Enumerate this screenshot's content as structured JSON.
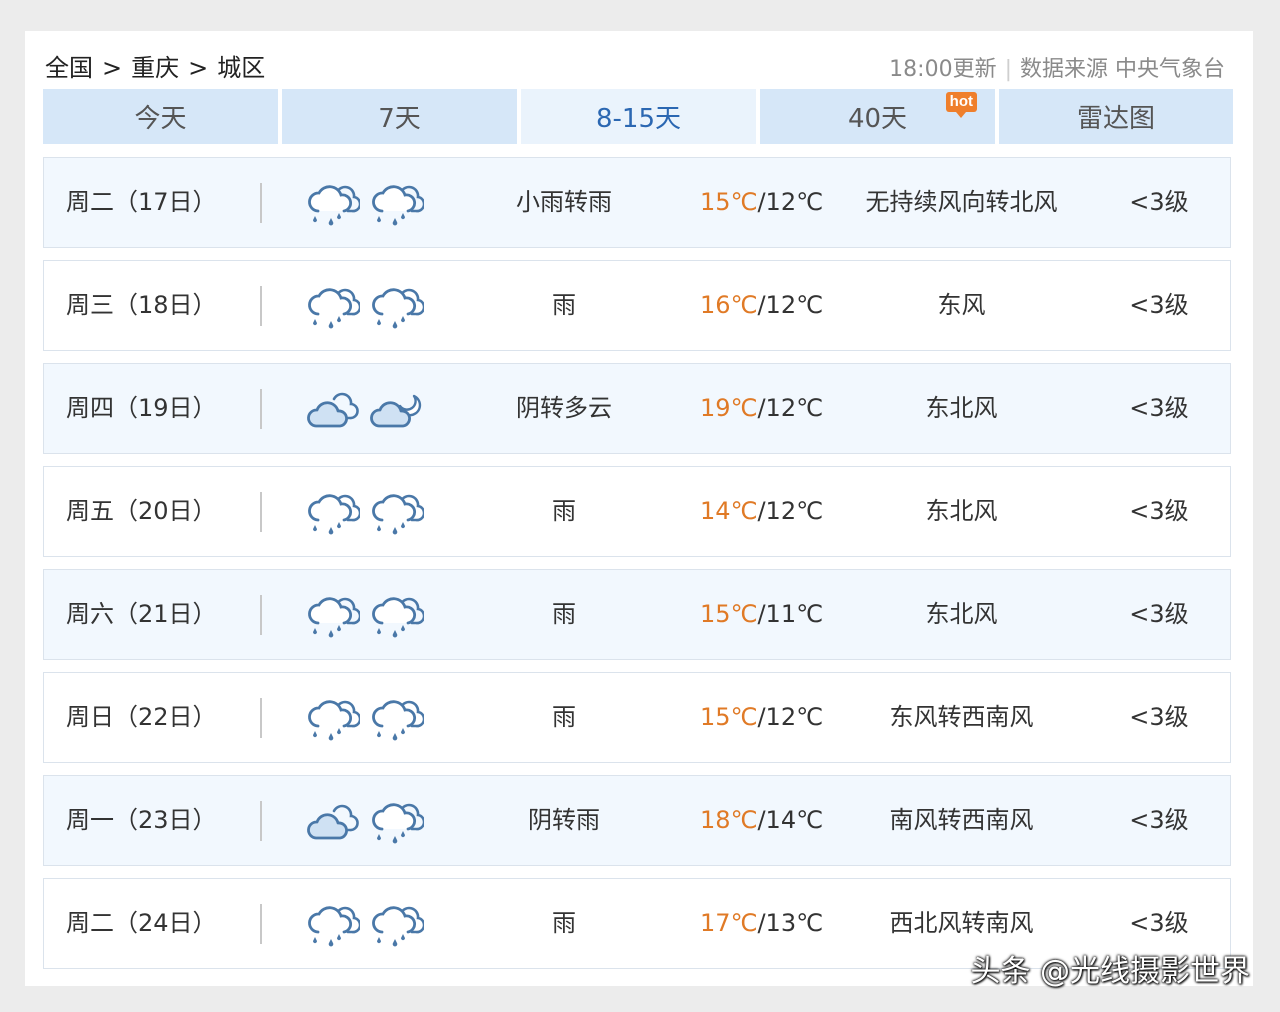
{
  "breadcrumb": {
    "country": "全国",
    "city": "重庆",
    "district": "城区",
    "separator": ">"
  },
  "header": {
    "update": "18:00更新",
    "source": "数据来源 中央气象台"
  },
  "tabs": [
    {
      "label": "今天"
    },
    {
      "label": "7天"
    },
    {
      "label": "8-15天",
      "active": true
    },
    {
      "label": "40天",
      "badge": "hot"
    },
    {
      "label": "雷达图"
    }
  ],
  "colors": {
    "high_temp": "#e07a26",
    "active_tab": "#2b67b2",
    "tab_bg": "#d6e7f8",
    "row_alt_bg": "#f2f8fe"
  },
  "forecast": [
    {
      "day": "周二（17日）",
      "icon_day": "rain-cloud-icon",
      "icon_night": "rain-cloud-icon",
      "weather": "小雨转雨",
      "high": "15℃",
      "sep": "/",
      "low": "12℃",
      "wind": "无持续风向转北风",
      "level": "<3级"
    },
    {
      "day": "周三（18日）",
      "icon_day": "rain-cloud-icon",
      "icon_night": "rain-cloud-icon",
      "weather": "雨",
      "high": "16℃",
      "sep": "/",
      "low": "12℃",
      "wind": "东风",
      "level": "<3级"
    },
    {
      "day": "周四（19日）",
      "icon_day": "overcast-cloud-icon",
      "icon_night": "cloudy-night-icon",
      "weather": "阴转多云",
      "high": "19℃",
      "sep": "/",
      "low": "12℃",
      "wind": "东北风",
      "level": "<3级"
    },
    {
      "day": "周五（20日）",
      "icon_day": "rain-cloud-icon",
      "icon_night": "rain-cloud-icon",
      "weather": "雨",
      "high": "14℃",
      "sep": "/",
      "low": "12℃",
      "wind": "东北风",
      "level": "<3级"
    },
    {
      "day": "周六（21日）",
      "icon_day": "rain-cloud-icon",
      "icon_night": "rain-cloud-icon",
      "weather": "雨",
      "high": "15℃",
      "sep": "/",
      "low": "11℃",
      "wind": "东北风",
      "level": "<3级"
    },
    {
      "day": "周日（22日）",
      "icon_day": "rain-cloud-icon",
      "icon_night": "rain-cloud-icon",
      "weather": "雨",
      "high": "15℃",
      "sep": "/",
      "low": "12℃",
      "wind": "东风转西南风",
      "level": "<3级"
    },
    {
      "day": "周一（23日）",
      "icon_day": "overcast-cloud-icon",
      "icon_night": "rain-cloud-icon",
      "weather": "阴转雨",
      "high": "18℃",
      "sep": "/",
      "low": "14℃",
      "wind": "南风转西南风",
      "level": "<3级"
    },
    {
      "day": "周二（24日）",
      "icon_day": "rain-cloud-icon",
      "icon_night": "rain-cloud-icon",
      "weather": "雨",
      "high": "17℃",
      "sep": "/",
      "low": "13℃",
      "wind": "西北风转南风",
      "level": "<3级"
    }
  ],
  "watermark": "头条 @光线摄影世界"
}
